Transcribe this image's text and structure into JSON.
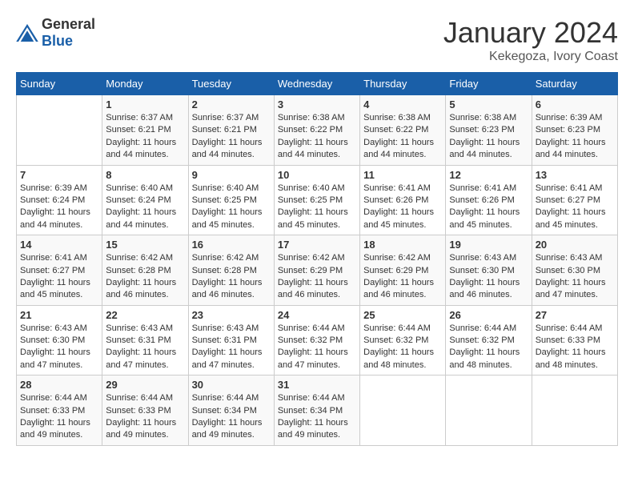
{
  "header": {
    "logo": {
      "general": "General",
      "blue": "Blue"
    },
    "title": "January 2024",
    "location": "Kekegoza, Ivory Coast"
  },
  "weekdays": [
    "Sunday",
    "Monday",
    "Tuesday",
    "Wednesday",
    "Thursday",
    "Friday",
    "Saturday"
  ],
  "weeks": [
    [
      {
        "day": "",
        "sunrise": "",
        "sunset": "",
        "daylight": ""
      },
      {
        "day": "1",
        "sunrise": "6:37 AM",
        "sunset": "6:21 PM",
        "daylight": "11 hours and 44 minutes."
      },
      {
        "day": "2",
        "sunrise": "6:37 AM",
        "sunset": "6:21 PM",
        "daylight": "11 hours and 44 minutes."
      },
      {
        "day": "3",
        "sunrise": "6:38 AM",
        "sunset": "6:22 PM",
        "daylight": "11 hours and 44 minutes."
      },
      {
        "day": "4",
        "sunrise": "6:38 AM",
        "sunset": "6:22 PM",
        "daylight": "11 hours and 44 minutes."
      },
      {
        "day": "5",
        "sunrise": "6:38 AM",
        "sunset": "6:23 PM",
        "daylight": "11 hours and 44 minutes."
      },
      {
        "day": "6",
        "sunrise": "6:39 AM",
        "sunset": "6:23 PM",
        "daylight": "11 hours and 44 minutes."
      }
    ],
    [
      {
        "day": "7",
        "sunrise": "6:39 AM",
        "sunset": "6:24 PM",
        "daylight": "11 hours and 44 minutes."
      },
      {
        "day": "8",
        "sunrise": "6:40 AM",
        "sunset": "6:24 PM",
        "daylight": "11 hours and 44 minutes."
      },
      {
        "day": "9",
        "sunrise": "6:40 AM",
        "sunset": "6:25 PM",
        "daylight": "11 hours and 45 minutes."
      },
      {
        "day": "10",
        "sunrise": "6:40 AM",
        "sunset": "6:25 PM",
        "daylight": "11 hours and 45 minutes."
      },
      {
        "day": "11",
        "sunrise": "6:41 AM",
        "sunset": "6:26 PM",
        "daylight": "11 hours and 45 minutes."
      },
      {
        "day": "12",
        "sunrise": "6:41 AM",
        "sunset": "6:26 PM",
        "daylight": "11 hours and 45 minutes."
      },
      {
        "day": "13",
        "sunrise": "6:41 AM",
        "sunset": "6:27 PM",
        "daylight": "11 hours and 45 minutes."
      }
    ],
    [
      {
        "day": "14",
        "sunrise": "6:41 AM",
        "sunset": "6:27 PM",
        "daylight": "11 hours and 45 minutes."
      },
      {
        "day": "15",
        "sunrise": "6:42 AM",
        "sunset": "6:28 PM",
        "daylight": "11 hours and 46 minutes."
      },
      {
        "day": "16",
        "sunrise": "6:42 AM",
        "sunset": "6:28 PM",
        "daylight": "11 hours and 46 minutes."
      },
      {
        "day": "17",
        "sunrise": "6:42 AM",
        "sunset": "6:29 PM",
        "daylight": "11 hours and 46 minutes."
      },
      {
        "day": "18",
        "sunrise": "6:42 AM",
        "sunset": "6:29 PM",
        "daylight": "11 hours and 46 minutes."
      },
      {
        "day": "19",
        "sunrise": "6:43 AM",
        "sunset": "6:30 PM",
        "daylight": "11 hours and 46 minutes."
      },
      {
        "day": "20",
        "sunrise": "6:43 AM",
        "sunset": "6:30 PM",
        "daylight": "11 hours and 47 minutes."
      }
    ],
    [
      {
        "day": "21",
        "sunrise": "6:43 AM",
        "sunset": "6:30 PM",
        "daylight": "11 hours and 47 minutes."
      },
      {
        "day": "22",
        "sunrise": "6:43 AM",
        "sunset": "6:31 PM",
        "daylight": "11 hours and 47 minutes."
      },
      {
        "day": "23",
        "sunrise": "6:43 AM",
        "sunset": "6:31 PM",
        "daylight": "11 hours and 47 minutes."
      },
      {
        "day": "24",
        "sunrise": "6:44 AM",
        "sunset": "6:32 PM",
        "daylight": "11 hours and 47 minutes."
      },
      {
        "day": "25",
        "sunrise": "6:44 AM",
        "sunset": "6:32 PM",
        "daylight": "11 hours and 48 minutes."
      },
      {
        "day": "26",
        "sunrise": "6:44 AM",
        "sunset": "6:32 PM",
        "daylight": "11 hours and 48 minutes."
      },
      {
        "day": "27",
        "sunrise": "6:44 AM",
        "sunset": "6:33 PM",
        "daylight": "11 hours and 48 minutes."
      }
    ],
    [
      {
        "day": "28",
        "sunrise": "6:44 AM",
        "sunset": "6:33 PM",
        "daylight": "11 hours and 49 minutes."
      },
      {
        "day": "29",
        "sunrise": "6:44 AM",
        "sunset": "6:33 PM",
        "daylight": "11 hours and 49 minutes."
      },
      {
        "day": "30",
        "sunrise": "6:44 AM",
        "sunset": "6:34 PM",
        "daylight": "11 hours and 49 minutes."
      },
      {
        "day": "31",
        "sunrise": "6:44 AM",
        "sunset": "6:34 PM",
        "daylight": "11 hours and 49 minutes."
      },
      {
        "day": "",
        "sunrise": "",
        "sunset": "",
        "daylight": ""
      },
      {
        "day": "",
        "sunrise": "",
        "sunset": "",
        "daylight": ""
      },
      {
        "day": "",
        "sunrise": "",
        "sunset": "",
        "daylight": ""
      }
    ]
  ],
  "labels": {
    "sunrise_prefix": "Sunrise: ",
    "sunset_prefix": "Sunset: ",
    "daylight_prefix": "Daylight: "
  }
}
